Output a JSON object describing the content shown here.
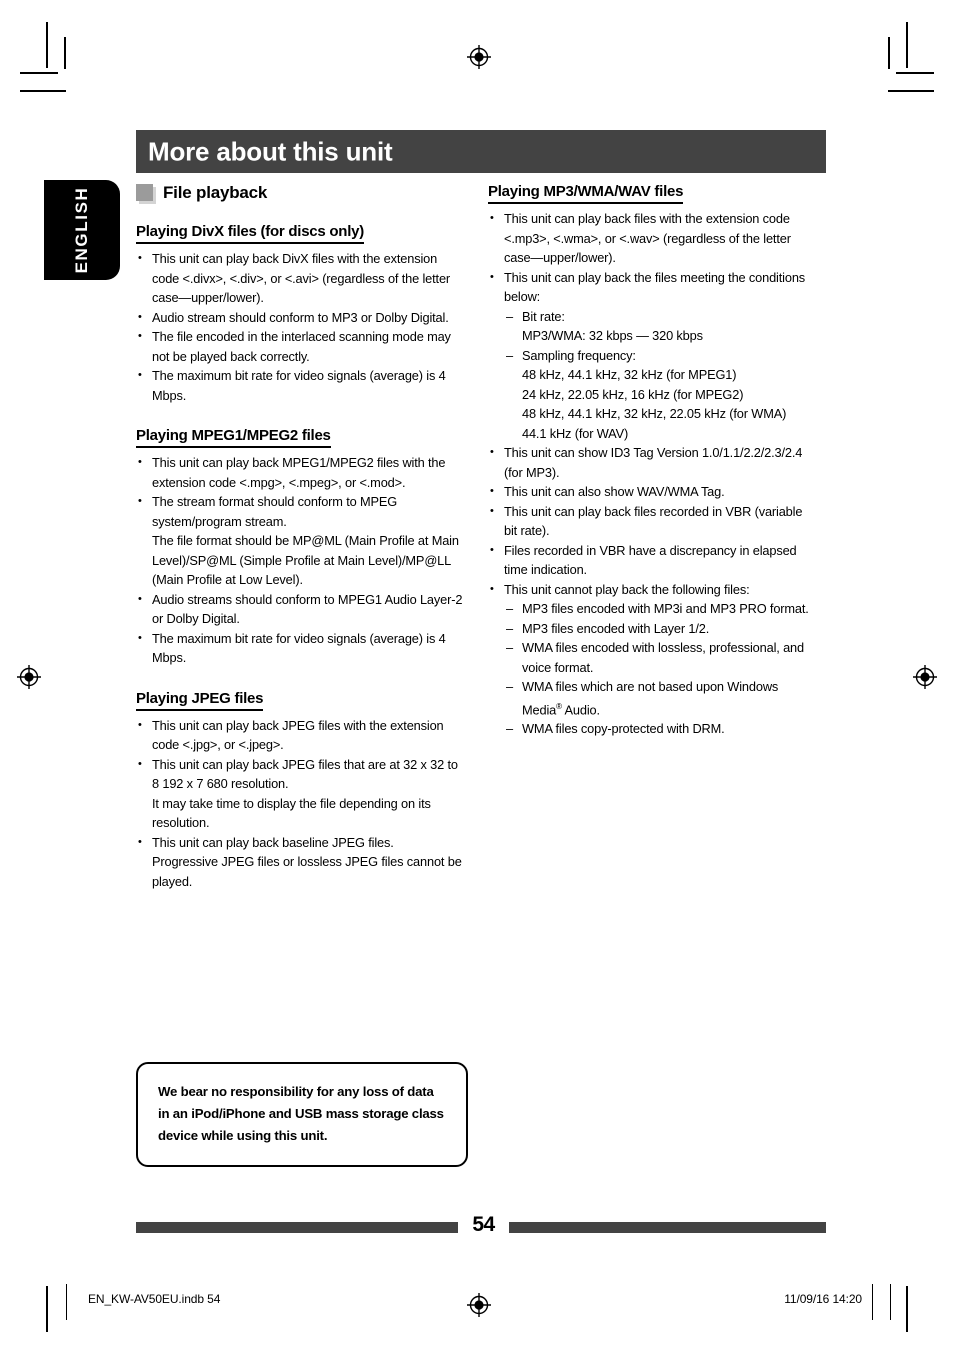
{
  "page": {
    "language_tab": "ENGLISH",
    "chapter_title": "More about this unit",
    "page_number": "54",
    "footer_file": "EN_KW-AV50EU.indb   54",
    "footer_timestamp": "11/09/16   14:20",
    "colors": {
      "header_bar": "#434343",
      "tab_background": "#000000",
      "square_icon": "#9b9b9b",
      "square_icon_shadow": "#d4d4d4",
      "text": "#000000"
    }
  },
  "section": {
    "icon": "square-bullet-icon",
    "label": "File playback"
  },
  "left_column": {
    "divx": {
      "heading": "Playing DivX files (for discs only)",
      "bullets": [
        "This unit can play back DivX files with the extension code <.divx>, <.div>, or <.avi> (regardless of the letter case—upper/lower).",
        "Audio stream should conform to MP3 or Dolby Digital.",
        "The file encoded in the interlaced scanning mode may not be played back correctly.",
        "The maximum bit rate for video signals (average) is 4 Mbps."
      ]
    },
    "mpeg": {
      "heading": "Playing MPEG1/MPEG2 files",
      "bullets": [
        "This unit can play back MPEG1/MPEG2 files with the extension code <.mpg>, <.mpeg>, or <.mod>.",
        "The stream format should conform to MPEG system/program stream.",
        "The file format should be MP@ML (Main Profile at Main Level)/SP@ML (Simple Profile at Main Level)/MP@LL (Main Profile at Low Level).",
        "Audio streams should conform to MPEG1 Audio Layer-2 or Dolby Digital.",
        "The maximum bit rate for video signals (average) is 4 Mbps."
      ]
    },
    "jpeg": {
      "heading": "Playing JPEG files",
      "bullets": [
        "This unit can play back JPEG files with the extension code <.jpg>, or <.jpeg>.",
        "This unit can play back JPEG files that are at 32 x 32 to 8 192 x 7 680 resolution.",
        "It may take time to display the file depending on its resolution.",
        "This unit can play back baseline JPEG files.",
        "Progressive JPEG files or lossless JPEG files cannot be played."
      ]
    },
    "notice": "We bear no responsibility for any loss of data in an iPod/iPhone and USB mass storage class device while using this unit."
  },
  "right_column": {
    "mp3": {
      "heading": "Playing MP3/WMA/WAV files",
      "bullet_1": "This unit can play back files with the extension code <.mp3>, <.wma>, or <.wav> (regardless of the letter case—upper/lower).",
      "bullet_2": "This unit can play back the files meeting the conditions below:",
      "conditions": {
        "bit_rate_label": "Bit rate:",
        "bit_rate_value": "MP3/WMA: 32 kbps — 320 kbps",
        "sampling_label": "Sampling frequency:",
        "sampling_values": [
          "48 kHz, 44.1 kHz, 32 kHz (for MPEG1)",
          "24 kHz, 22.05 kHz, 16 kHz (for MPEG2)",
          "48 kHz, 44.1 kHz, 32 kHz, 22.05 kHz (for WMA)",
          "44.1 kHz (for WAV)"
        ]
      },
      "bullet_3": "This unit can show ID3 Tag Version 1.0/1.1/2.2/2.3/2.4 (for MP3).",
      "bullet_4": "This unit can also show WAV/WMA Tag.",
      "bullet_5": "This unit can play back files recorded in VBR (variable bit rate).",
      "bullet_6": "Files recorded in VBR have a discrepancy in elapsed time indication.",
      "bullet_7": "This unit cannot play back the following files:",
      "unsupported": [
        "MP3 files encoded with MP3i and MP3 PRO format.",
        "MP3 files encoded with Layer 1/2.",
        "WMA files encoded with lossless, professional, and voice format.",
        "WMA files copy-protected with DRM."
      ],
      "unsupported_windows_media_prefix": "WMA files which are not based upon Windows Media",
      "unsupported_windows_media_suffix": " Audio.",
      "registered_mark": "®"
    }
  }
}
